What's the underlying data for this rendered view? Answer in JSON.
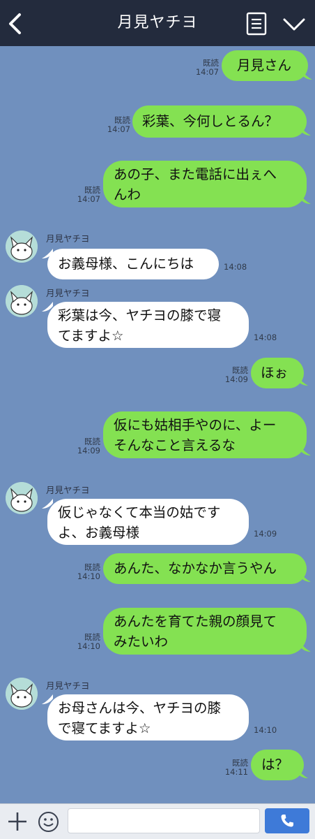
{
  "header": {
    "title": "月見ヤチヨ",
    "back_icon": "chevron-left-icon",
    "menu_icon": "list-icon",
    "dropdown_icon": "chevron-down-icon"
  },
  "colors": {
    "background": "#7090be",
    "header": "#232b3d",
    "outgoing_bubble": "#84e152",
    "incoming_bubble": "#ffffff",
    "send_button": "#3e7ad8"
  },
  "messages": [
    {
      "side": "me",
      "text": "月見さん",
      "read": "既読",
      "time": "14:07"
    },
    {
      "side": "me",
      "text": "彩葉、今何しとるん？",
      "read": "既読",
      "time": "14:07"
    },
    {
      "side": "me",
      "text": "あの子、また電話に出ぇへ\nんわ",
      "read": "既読",
      "time": "14:07"
    },
    {
      "side": "them",
      "sender": "月見ヤチヨ",
      "text": "お義母様、こんにちは",
      "time": "14:08"
    },
    {
      "side": "them",
      "sender": "月見ヤチヨ",
      "text": "彩葉は今、ヤチヨの膝で寝\nてますよ☆",
      "time": "14:08"
    },
    {
      "side": "me",
      "text": "ほぉ",
      "read": "既読",
      "time": "14:09"
    },
    {
      "side": "me",
      "text": "仮にも姑相手やのに、よー\nそんなこと言えるな",
      "read": "既読",
      "time": "14:09"
    },
    {
      "side": "them",
      "sender": "月見ヤチヨ",
      "text": "仮じゃなくて本当の姑です\nよ、お義母様",
      "time": "14:09"
    },
    {
      "side": "me",
      "text": "あんた、なかなか言うやん",
      "read": "既読",
      "time": "14:10"
    },
    {
      "side": "me",
      "text": "あんたを育てた親の顔見て\nみたいわ",
      "read": "既読",
      "time": "14:10"
    },
    {
      "side": "them",
      "sender": "月見ヤチヨ",
      "text": "お母さんは今、ヤチヨの膝\nで寝てますよ☆",
      "time": "14:10"
    },
    {
      "side": "me",
      "text": "は？",
      "read": "既読",
      "time": "14:11"
    }
  ],
  "input_bar": {
    "plus_icon": "plus-icon",
    "emoji_icon": "smiley-icon",
    "field_value": "",
    "send_icon": "phone-icon"
  }
}
